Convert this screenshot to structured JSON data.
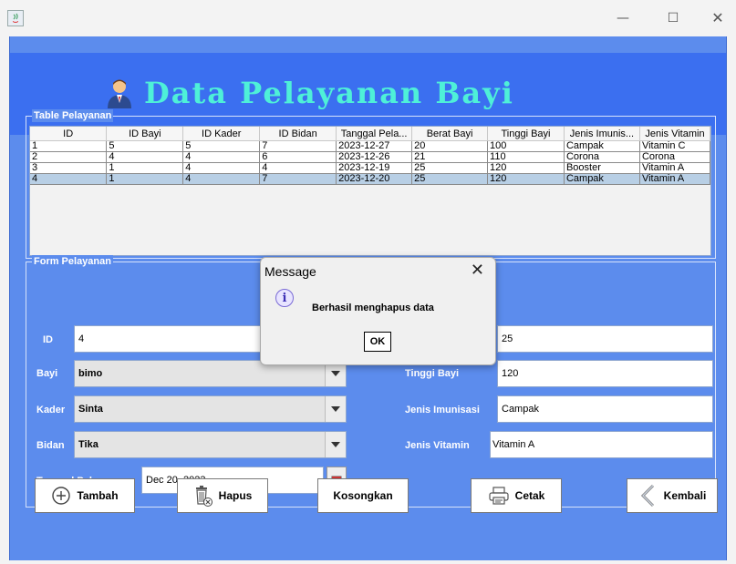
{
  "window": {
    "minimize": "—",
    "maximize": "☐",
    "close": "✕"
  },
  "header": {
    "title": "Data Pelayanan Bayi"
  },
  "table_panel": {
    "title": "Table Pelayanan",
    "columns": [
      "ID",
      "ID Bayi",
      "ID Kader",
      "ID Bidan",
      "Tanggal Pela...",
      "Berat Bayi",
      "Tinggi Bayi",
      "Jenis Imunis...",
      "Jenis Vitamin"
    ],
    "rows": [
      [
        "1",
        "5",
        "5",
        "7",
        "2023-12-27",
        "20",
        "100",
        "Campak",
        "Vitamin C"
      ],
      [
        "2",
        "4",
        "4",
        "6",
        "2023-12-26",
        "21",
        "110",
        "Corona",
        "Corona"
      ],
      [
        "3",
        "1",
        "4",
        "4",
        "2023-12-19",
        "25",
        "120",
        "Booster",
        "Vitamin A"
      ],
      [
        "4",
        "1",
        "4",
        "7",
        "2023-12-20",
        "25",
        "120",
        "Campak",
        "Vitamin A"
      ]
    ]
  },
  "form_panel": {
    "title": "Form Pelayanan",
    "id_label": "ID",
    "id_value": "4",
    "bayi_label": "Bayi",
    "bayi_value": "bimo",
    "kader_label": "Kader",
    "kader_value": "Sinta",
    "bidan_label": "Bidan",
    "bidan_value": "Tika",
    "tanggal_label": "Tanggal Pelayanan",
    "tanggal_value": "Dec 20, 2023",
    "berat_value": "25",
    "tinggi_label": "Tinggi Bayi",
    "tinggi_value": "120",
    "imunisasi_label": "Jenis Imunisasi",
    "imunisasi_value": "Campak",
    "vitamin_label": "Jenis Vitamin",
    "vitamin_value": "Vitamin A"
  },
  "buttons": {
    "tambah": "Tambah",
    "hapus": "Hapus",
    "kosongkan": "Kosongkan",
    "cetak": "Cetak",
    "kembali": "Kembali"
  },
  "dialog": {
    "title": "Message",
    "close": "✕",
    "icon": "i",
    "message": "Berhasil menghapus data",
    "ok": "OK"
  },
  "colors": {
    "frame": "#5c8ced",
    "header": "#3b6ff0",
    "title": "#4ef0d8",
    "selected_row": "#b8cfe5"
  }
}
